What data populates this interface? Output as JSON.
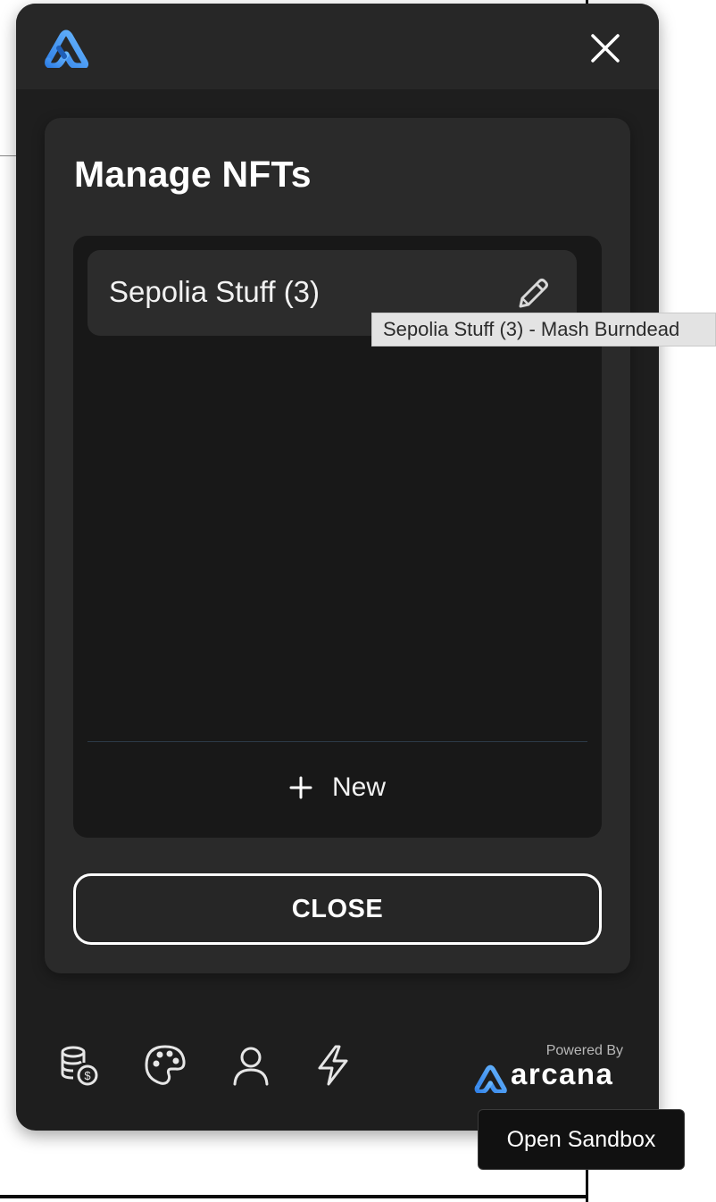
{
  "header": {
    "logo_icon": "arcana-logo-icon",
    "close_icon": "close-icon"
  },
  "card": {
    "title": "Manage NFTs",
    "list_items": [
      {
        "label": "Sepolia Stuff (3)",
        "edit_icon": "pencil-icon"
      }
    ],
    "new_button": {
      "label": "New",
      "icon": "plus-icon"
    },
    "close_button": "CLOSE"
  },
  "footer": {
    "nav_icons": [
      "tokens-icon",
      "palette-icon",
      "user-icon",
      "lightning-icon"
    ],
    "powered_by": "Powered By",
    "brand": "arcana"
  },
  "tooltip": "Sepolia Stuff (3) - Mash Burndead",
  "sandbox_button": "Open Sandbox",
  "colors": {
    "widget_bg": "#1e1e1e",
    "card_bg": "#2a2a2a",
    "accent_blue": "#3d8ef0"
  }
}
